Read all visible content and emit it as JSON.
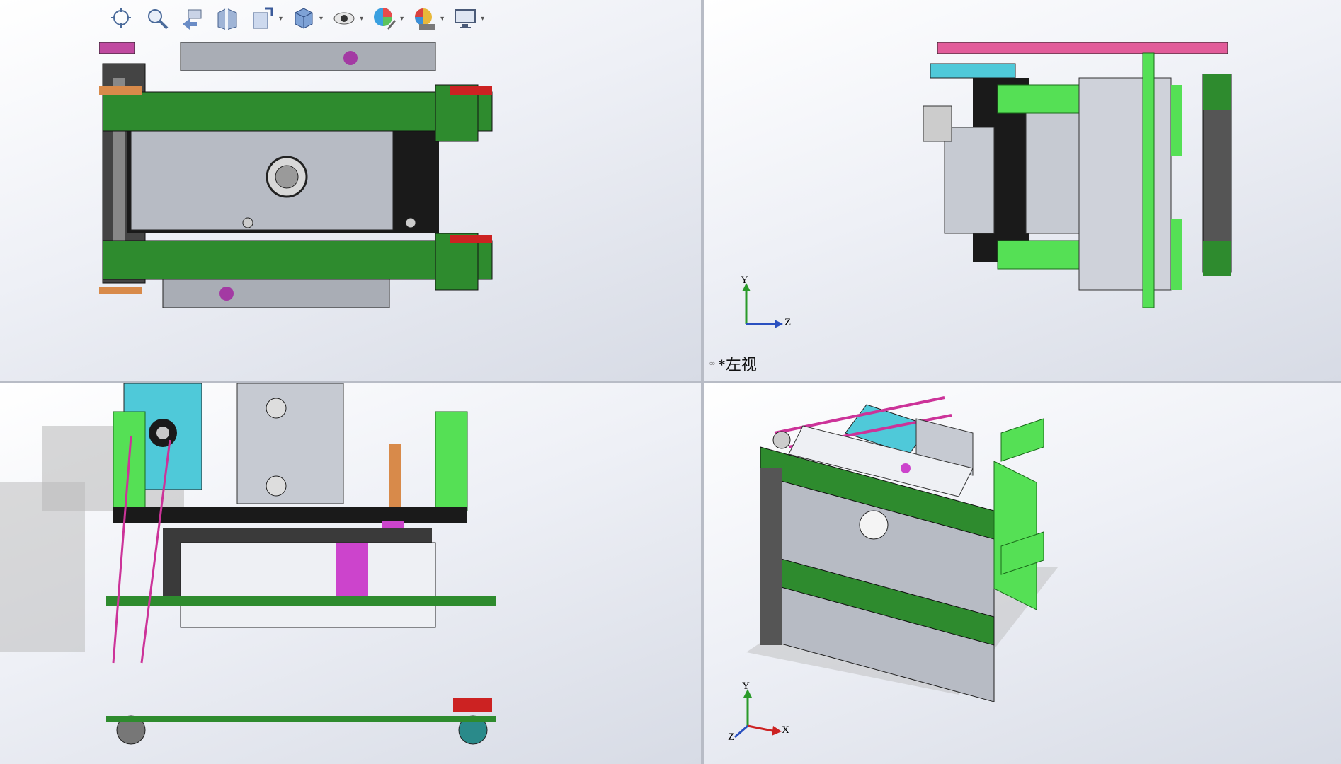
{
  "toolbar": {
    "items": [
      {
        "name": "zoom-to-fit-icon"
      },
      {
        "name": "zoom-to-area-icon"
      },
      {
        "name": "previous-view-icon"
      },
      {
        "name": "section-view-icon"
      },
      {
        "name": "view-orientation-icon"
      },
      {
        "name": "display-style-icon"
      },
      {
        "name": "hide-show-items-icon"
      },
      {
        "name": "edit-appearance-icon"
      },
      {
        "name": "apply-scene-icon"
      },
      {
        "name": "view-settings-icon"
      }
    ]
  },
  "viewports": {
    "top_right": {
      "label": "*左视",
      "axes": {
        "y": "Y",
        "z": "Z"
      }
    },
    "bottom_right": {
      "axes": {
        "y": "Y",
        "x": "X",
        "z": "Z"
      }
    }
  },
  "colors": {
    "green_dark": "#2e8b2e",
    "green_light": "#55e055",
    "magenta": "#cc3399",
    "pink": "#e25c9a",
    "cyan": "#4fc9d9",
    "grey_plate": "#a9adb5",
    "black": "#1a1a1a",
    "orange": "#d88a4a",
    "red": "#cc2222"
  }
}
